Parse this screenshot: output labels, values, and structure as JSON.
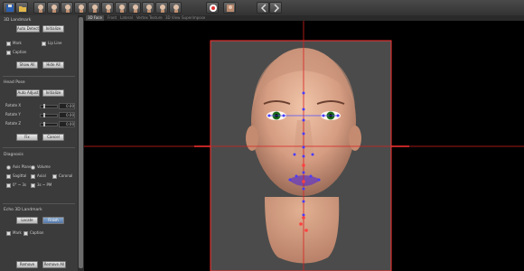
{
  "toolbar": {
    "icons": [
      "save-icon",
      "open-icon",
      "head-icon",
      "head-icon",
      "head-icon",
      "head-icon",
      "head-icon",
      "head-icon",
      "head-icon",
      "head-icon",
      "head-icon",
      "head-icon",
      "head-icon",
      "landmark-icon",
      "face-icon",
      "back-icon",
      "forward-icon"
    ]
  },
  "tabs": [
    "3D Face",
    "Front",
    "Lateral",
    "Vertex",
    "Texture",
    "3D View",
    "Superimpose"
  ],
  "panel": {
    "landmark_title": "3D Landmark",
    "auto_detect": "Auto Detect",
    "initialize": "Initialize",
    "mark": "Mark",
    "lip_line": "Lip Line",
    "caption": "Caption",
    "show_all": "Show All",
    "hide_all": "Hide All",
    "head_pose_title": "Head Pose",
    "auto_adjust": "Auto Adjust",
    "initialize2": "Initialize",
    "rotate_x": "Rotate X",
    "rotate_y": "Rotate Y",
    "rotate_z": "Rotate Z",
    "rx_val": "0.00",
    "ry_val": "0.00",
    "rz_val": "0.00",
    "fix": "Fix",
    "cancel": "Cancel",
    "diagnosis_title": "Diagnosis",
    "axis_plane": "Axis Plane",
    "volume": "Volume",
    "sagittal": "Sagittal",
    "axial": "Axial",
    "coronal": "Coronal",
    "opt_a": "0° ~ 3s",
    "opt_b": "3s ~ PM",
    "echo_title": "Echo 3D Landmark",
    "locate": "Locate",
    "finish": "Finish",
    "mark2": "Mark",
    "caption2": "Caption",
    "remove": "Remove",
    "remove_all": "Remove All"
  }
}
